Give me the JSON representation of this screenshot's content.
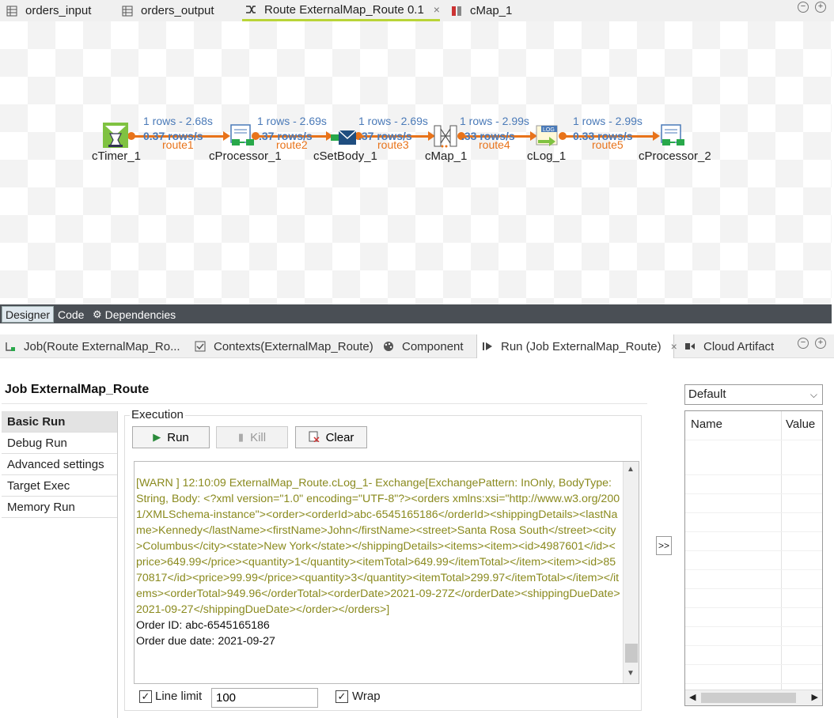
{
  "editor_tabs": [
    {
      "label": "orders_input"
    },
    {
      "label": "orders_output"
    },
    {
      "label": "Route ExternalMap_Route 0.1",
      "close": "×"
    },
    {
      "label": "cMap_1"
    }
  ],
  "editor_controls": {
    "minimize": "−",
    "maximize": "+"
  },
  "nodes": [
    {
      "label": "cTimer_1"
    },
    {
      "label": "cProcessor_1"
    },
    {
      "label": "cSetBody_1"
    },
    {
      "label": "cMap_1"
    },
    {
      "label": "cLog_1"
    },
    {
      "label": "cProcessor_2"
    }
  ],
  "flows": [
    {
      "rows": "1 rows - 2.68s",
      "rate": "0.37 rows/s",
      "route": "route1"
    },
    {
      "rows": "1 rows - 2.69s",
      "rate": ".37 rows/s",
      "route": "route2"
    },
    {
      "rows": "1 rows - 2.69s",
      "rate": ".37 rows/s",
      "route": "route3"
    },
    {
      "rows": "1 rows - 2.99s",
      "rate": ".33 rows/s",
      "route": "route4"
    },
    {
      "rows": "1 rows - 2.99s",
      "rate": "0.33 rows/s",
      "route": "route5"
    }
  ],
  "designer_tabs": [
    {
      "label": "Designer"
    },
    {
      "label": "Code"
    },
    {
      "label": "Dependencies"
    }
  ],
  "view_tabs": [
    {
      "label": "Job(Route ExternalMap_Ro..."
    },
    {
      "label": "Contexts(ExternalMap_Route)"
    },
    {
      "label": "Component"
    },
    {
      "label": "Run (Job ExternalMap_Route)",
      "close": "×"
    },
    {
      "label": "Cloud Artifact"
    }
  ],
  "run_panel": {
    "title": "Job ExternalMap_Route",
    "menu": [
      {
        "label": "Basic Run"
      },
      {
        "label": "Debug Run"
      },
      {
        "label": "Advanced settings"
      },
      {
        "label": "Target Exec"
      },
      {
        "label": "Memory Run"
      }
    ],
    "execution_label": "Execution",
    "buttons": {
      "run": "Run",
      "kill": "Kill",
      "clear": "Clear"
    },
    "console": {
      "warn": "[WARN ] 12:10:09 ExternalMap_Route.cLog_1- Exchange[ExchangePattern: InOnly, BodyType: String, Body: <?xml version=\"1.0\" encoding=\"UTF-8\"?><orders xmlns:xsi=\"http://www.w3.org/2001/XMLSchema-instance\"><order><orderId>abc-6545165186</orderId><shippingDetails><lastName>Kennedy</lastName><firstName>John</firstName><street>Santa Rosa South</street><city>Columbus</city><state>New York</state></shippingDetails><items><item><id>4987601</id><price>649.99</price><quantity>1</quantity><itemTotal>649.99</itemTotal></item><item><id>8570817</id><price>99.99</price><quantity>3</quantity><itemTotal>299.97</itemTotal></item></items><orderTotal>949.96</orderTotal><orderDate>2021-09-27Z</orderDate><shippingDueDate>2021-09-27</shippingDueDate></order></orders>]",
      "order_id": "Order ID: abc-6545165186",
      "due_date": "Order due date: 2021-09-27"
    },
    "line_limit_label": "Line limit",
    "line_limit_value": "100",
    "line_limit_checked": true,
    "wrap_label": "Wrap",
    "wrap_checked": true,
    "expand_label": ">>"
  },
  "context_panel": {
    "selected": "Default",
    "columns": [
      "Name",
      "Value"
    ]
  },
  "colors": {
    "flow": "#e8731a",
    "stat": "#4a7ab8",
    "active_tab_underline": "#b9d437",
    "warn_text": "#8a8a1e"
  }
}
